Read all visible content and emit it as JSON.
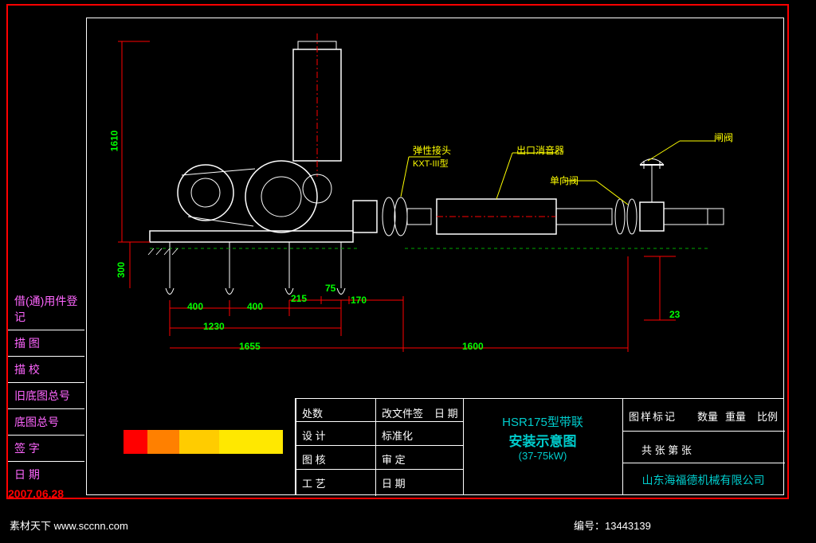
{
  "annotations": {
    "a1": "弹性接头",
    "a1_sub": "KXT-III型",
    "a2": "出口消音器",
    "a3": "闸阀",
    "a4": "单向阀"
  },
  "dimensions": {
    "h1610": "1610",
    "h300": "300",
    "w400a": "400",
    "w400b": "400",
    "w215": "215",
    "w75": "75",
    "w170": "170",
    "w1230": "1230",
    "w1655": "1655",
    "w1600": "1600",
    "d23": "23"
  },
  "side_panel": {
    "s1": "借(通)用件登记",
    "s2": "描  图",
    "s3": "描  校",
    "s4": "旧底图总号",
    "s5": "底图总号",
    "s6": "签  字",
    "s7": "日  期"
  },
  "titleblock": {
    "tb_l1": "处数",
    "tb_l2": "设  计",
    "tb_l3": "图  核",
    "tb_l4": "工  艺",
    "tb_m1": "改文件签",
    "tb_m2": "标准化",
    "tb_m3": "审  定",
    "tb_m4": "日  期",
    "tb_m0": "日  期",
    "title1": "HSR175型带联",
    "title2": "安装示意图",
    "title3": "(37-75kW)",
    "tb_r1": "图样标记",
    "tb_r2": "数量",
    "tb_r3": "重量",
    "tb_r4": "比例",
    "tb_r5": "共    张  第    张",
    "company": "山东海福德机械有限公司"
  },
  "footer": {
    "left": "素材天下  www.sccnn.com",
    "right": "编号：13443139"
  },
  "date": "2007.06.28"
}
